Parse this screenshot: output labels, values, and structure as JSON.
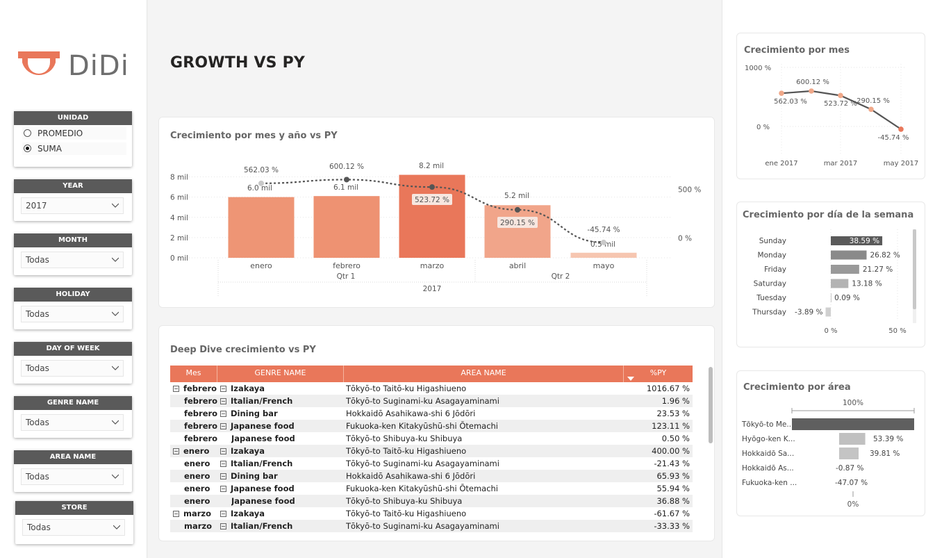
{
  "brand": {
    "name": "DiDi",
    "accent": "#e9775a"
  },
  "page_title": "GROWTH VS PY",
  "slicers": {
    "unidad": {
      "title": "UNIDAD",
      "options": [
        "PROMEDIO",
        "SUMA"
      ],
      "selected": "SUMA"
    },
    "year": {
      "title": "YEAR",
      "value": "2017"
    },
    "month": {
      "title": "MONTH",
      "value": "Todas"
    },
    "holiday": {
      "title": "HOLIDAY",
      "value": "Todas"
    },
    "day_of_week": {
      "title": "DAY OF WEEK",
      "value": "Todas"
    },
    "genre_name": {
      "title": "GENRE NAME",
      "value": "Todas"
    },
    "area_name": {
      "title": "AREA NAME",
      "value": "Todas"
    },
    "store": {
      "title": "STORE",
      "value": "Todas"
    }
  },
  "combo_chart": {
    "title": "Crecimiento por mes y año vs PY",
    "y_left_ticks": [
      "0 mil",
      "2 mil",
      "4 mil",
      "6 mil",
      "8 mil"
    ],
    "y_right_ticks": [
      "0 %",
      "500 %"
    ],
    "quarter_labels": [
      "Qtr 1",
      "Qtr 2"
    ],
    "year_label": "2017"
  },
  "table": {
    "title": "Deep Dive crecimiento vs PY",
    "columns": [
      "Mes",
      "GENRE NAME",
      "AREA NAME",
      "%PY"
    ],
    "rows": [
      {
        "mes": "febrero",
        "genre": "Izakaya",
        "area": "Tōkyō-to Taitō-ku Higashiueno",
        "py": "1016.67 %",
        "mes_exp": true,
        "genre_exp": true
      },
      {
        "mes": "febrero",
        "genre": "Italian/French",
        "area": "Tōkyō-to Suginami-ku Asagayaminami",
        "py": "1.96 %",
        "mes_exp": false,
        "genre_exp": true
      },
      {
        "mes": "febrero",
        "genre": "Dining bar",
        "area": "Hokkaidō Asahikawa-shi 6 Jōdōri",
        "py": "23.53 %",
        "mes_exp": false,
        "genre_exp": true
      },
      {
        "mes": "febrero",
        "genre": "Japanese food",
        "area": "Fukuoka-ken Kitakyūshū-shi Ōtemachi",
        "py": "123.11 %",
        "mes_exp": false,
        "genre_exp": true
      },
      {
        "mes": "febrero",
        "genre": "Japanese food",
        "area": "Tōkyō-to Shibuya-ku Shibuya",
        "py": "0.50 %",
        "mes_exp": false,
        "genre_exp": false
      },
      {
        "mes": "enero",
        "genre": "Izakaya",
        "area": "Tōkyō-to Taitō-ku Higashiueno",
        "py": "400.00 %",
        "mes_exp": true,
        "genre_exp": true
      },
      {
        "mes": "enero",
        "genre": "Italian/French",
        "area": "Tōkyō-to Suginami-ku Asagayaminami",
        "py": "-21.43 %",
        "mes_exp": false,
        "genre_exp": true
      },
      {
        "mes": "enero",
        "genre": "Dining bar",
        "area": "Hokkaidō Asahikawa-shi 6 Jōdōri",
        "py": "65.93 %",
        "mes_exp": false,
        "genre_exp": true
      },
      {
        "mes": "enero",
        "genre": "Japanese food",
        "area": "Fukuoka-ken Kitakyūshū-shi Ōtemachi",
        "py": "55.94 %",
        "mes_exp": false,
        "genre_exp": true
      },
      {
        "mes": "enero",
        "genre": "Japanese food",
        "area": "Tōkyō-to Shibuya-ku Shibuya",
        "py": "36.88 %",
        "mes_exp": false,
        "genre_exp": false
      },
      {
        "mes": "marzo",
        "genre": "Izakaya",
        "area": "Tōkyō-to Taitō-ku Higashiueno",
        "py": "-61.67 %",
        "mes_exp": true,
        "genre_exp": true
      },
      {
        "mes": "marzo",
        "genre": "Italian/French",
        "area": "Tōkyō-to Suginami-ku Asagayaminami",
        "py": "-33.33 %",
        "mes_exp": false,
        "genre_exp": true
      }
    ]
  },
  "chart_data": [
    {
      "type": "bar",
      "title": "Crecimiento por mes y año vs PY",
      "categories": [
        "enero",
        "febrero",
        "marzo",
        "abril",
        "mayo"
      ],
      "series": [
        {
          "values": [
            6.0,
            6.1,
            8.2,
            5.2,
            0.5
          ],
          "labels": [
            "6.0 mil",
            "6.1 mil",
            "8.2 mil",
            "5.2 mil",
            "0.5 mil"
          ]
        },
        {
          "values": [
            562.03,
            600.12,
            523.72,
            290.15,
            -45.74
          ],
          "labels": [
            "562.03 %",
            "600.12 %",
            "523.72 %",
            "290.15 %",
            "-45.74 %"
          ]
        }
      ],
      "ylim": [
        0,
        8
      ],
      "y2lim": [
        0,
        500
      ]
    },
    {
      "type": "line",
      "title": "Crecimiento por mes",
      "x_ticks": [
        "ene 2017",
        "mar 2017",
        "may 2017"
      ],
      "y_ticks": [
        "0 %",
        "1000 %"
      ],
      "series": [
        {
          "values": [
            562.03,
            600.12,
            523.72,
            290.15,
            -45.74
          ],
          "labels": [
            "562.03 %",
            "600.12 %",
            "523.72 %",
            "290.15 %",
            "-45.74 %"
          ]
        }
      ]
    },
    {
      "type": "bar",
      "title": "Crecimiento por día de la semana",
      "categories": [
        "Sunday",
        "Monday",
        "Friday",
        "Saturday",
        "Tuesday",
        "Thursday"
      ],
      "values": [
        38.59,
        26.82,
        21.27,
        13.18,
        0.09,
        -3.89
      ],
      "labels": [
        "38.59 %",
        "26.82 %",
        "21.27 %",
        "13.18 %",
        "0.09 %",
        "-3.89 %"
      ],
      "x_ticks": [
        "0 %",
        "50 %"
      ]
    },
    {
      "type": "bar",
      "title": "Crecimiento por área",
      "categories": [
        "Tōkyō-to Me...",
        "Hyōgo-ken K...",
        "Hokkaidō Sa...",
        "Hokkaidō As...",
        "Fukuoka-ken ..."
      ],
      "values": [
        100,
        53.39,
        39.81,
        -0.87,
        -47.07
      ],
      "labels": [
        "",
        "53.39 %",
        "39.81 %",
        "-0.87 %",
        "-47.07 %"
      ],
      "top_label": "100%",
      "bottom_label": "0%"
    }
  ]
}
